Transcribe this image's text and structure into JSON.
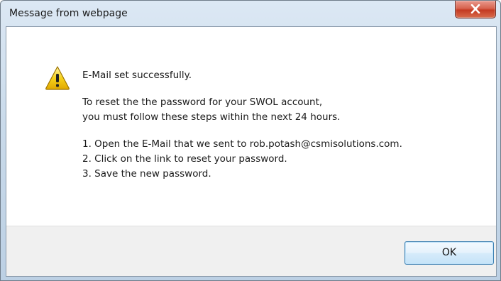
{
  "window": {
    "title": "Message from webpage",
    "close_icon": "close-icon"
  },
  "message": {
    "icon": "warning-icon",
    "headline": "E-Mail set successfully.",
    "intro": [
      "To reset the the password for your SWOL account,",
      "you must follow these steps within the next 24 hours."
    ],
    "steps": [
      "1. Open the E-Mail that we sent to rob.potash@csmisolutions.com.",
      "2. Click on the link to reset your password.",
      "3. Save the new password."
    ]
  },
  "buttons": {
    "ok_label": "OK"
  },
  "colors": {
    "close_button": "#c43a22",
    "ok_border": "#3c7fb1",
    "warning_fill": "#f5c400",
    "footer_bg": "#f0f0f0"
  }
}
